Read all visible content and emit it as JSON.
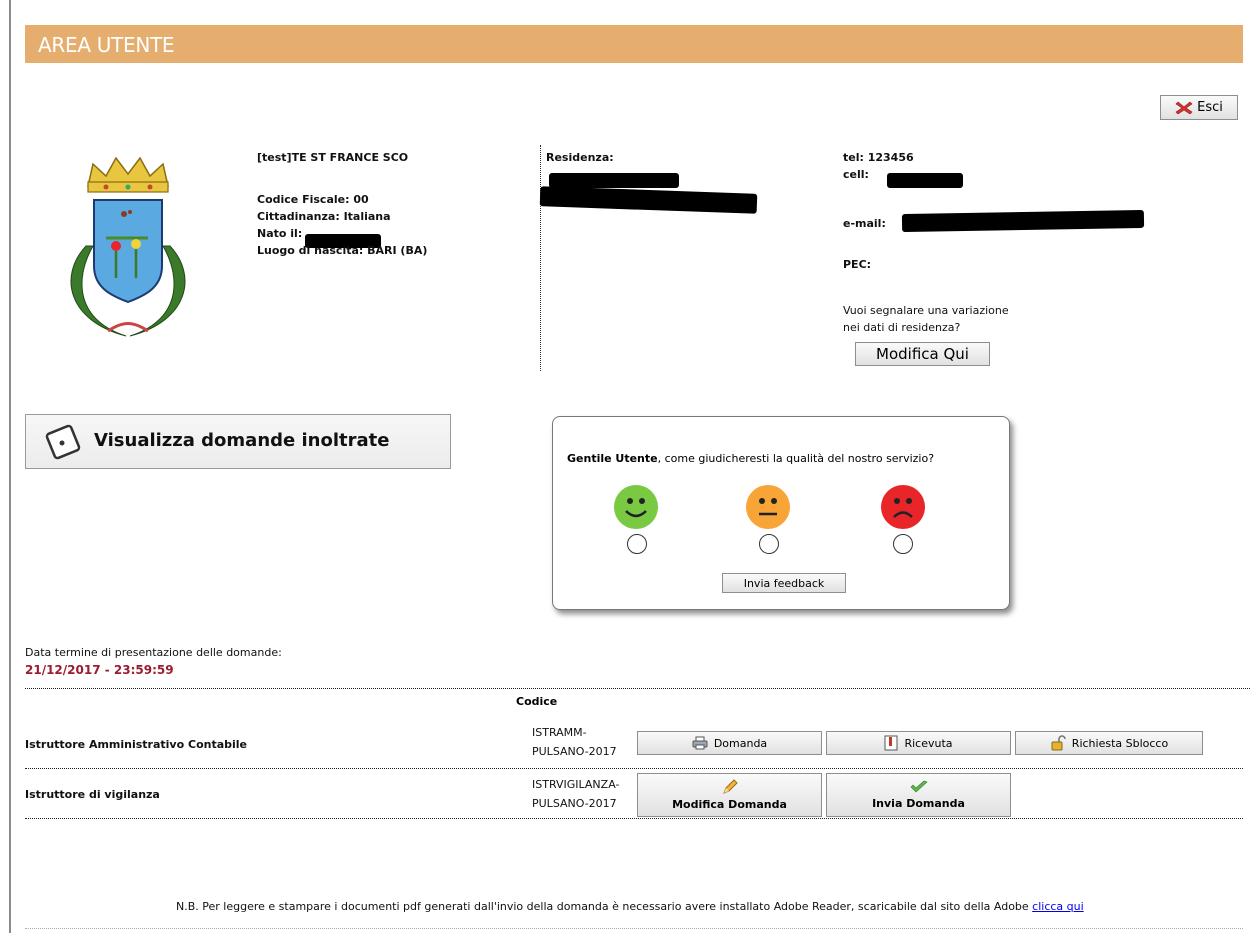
{
  "header": {
    "title": "AREA UTENTE"
  },
  "logout": {
    "label": "Esci"
  },
  "user": {
    "name": "[test]TE ST FRANCE SCO",
    "codice_fiscale": "Codice Fiscale: 00",
    "cittadinanza": "Cittadinanza: Italiana",
    "nato_il": "Nato il:",
    "luogo_nascita": "Luogo di nascita: BARI (BA)"
  },
  "residenza": {
    "label": "Residenza:"
  },
  "contacts": {
    "tel": "tel: 123456",
    "cell": "cell:",
    "email": "e-mail:",
    "pec": "PEC:",
    "variazione_q1": "Vuoi segnalare una variazione",
    "variazione_q2": "nei dati di residenza?",
    "modifica_btn": "Modifica Qui"
  },
  "visualizza": {
    "label": "Visualizza domande inoltrate"
  },
  "feedback": {
    "question_bold": "Gentile Utente",
    "question_rest": ", come giudicheresti la qualità del nostro servizio?",
    "submit": "Invia feedback",
    "colors": {
      "good": "#7ac943",
      "neutral": "#f7a536",
      "bad": "#e8262a"
    }
  },
  "deadline": {
    "label": "Data termine di presentazione delle domande:",
    "value": "21/12/2017 - 23:59:59"
  },
  "table": {
    "code_header": "Codice",
    "rows": [
      {
        "label": "Istruttore Amministrativo Contabile",
        "code_line1": "ISTRAMM-",
        "code_line2": "PULSANO-2017",
        "actions": [
          "Domanda",
          "Ricevuta",
          "Richiesta Sblocco"
        ]
      },
      {
        "label": "Istruttore di vigilanza",
        "code_line1": "ISTRVIGILANZA-",
        "code_line2": "PULSANO-2017",
        "actions": [
          "Modifica Domanda",
          "Invia Domanda"
        ]
      }
    ]
  },
  "footer": {
    "note": "N.B. Per leggere e stampare i documenti pdf generati dall'invio della domanda è necessario avere installato Adobe Reader, scaricabile dal sito della Adobe ",
    "link": "clicca qui"
  }
}
